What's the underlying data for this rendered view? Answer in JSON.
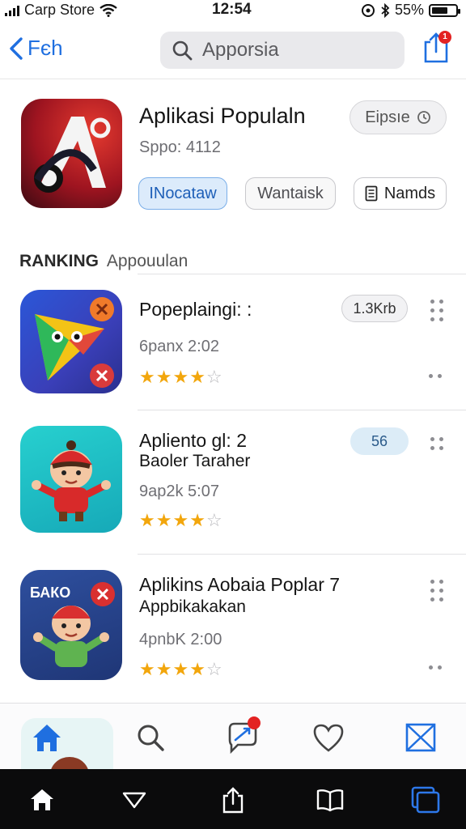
{
  "status_bar": {
    "carrier": "Carp Store",
    "time": "12:54",
    "battery": "55%",
    "battery_level": 0.55
  },
  "nav": {
    "back_label": "Fєh",
    "search_text": "Apporsia",
    "share_badge": "1"
  },
  "featured": {
    "title": "Aplikasi Populaln",
    "meta": "Sppo: 4112",
    "top_pill": "Eipsıe",
    "buttons": [
      "INocataw",
      "Wantaisk",
      "Namds"
    ]
  },
  "section": {
    "heading_strong": "RANKING",
    "heading_light": "Appouulan"
  },
  "apps": [
    {
      "title": "Popeplaingi: :",
      "meta": "6panx 2:02",
      "pill": "1.3Krb",
      "rating": 4
    },
    {
      "title": "Apliento gl: 2",
      "subtitle": "Baoler Taraher",
      "meta": "9ap2k 5:07",
      "pill": "56",
      "rating": 4
    },
    {
      "title": "Aplikins Aobaia Poplar 7",
      "subtitle": "Appbikakakan",
      "icon_text": "БАКО",
      "meta": "4pnbK 2:00",
      "rating": 4
    }
  ],
  "icons": {
    "back": "chevron-left-icon",
    "search": "search-icon",
    "share": "share-icon",
    "tabs": [
      "home-icon",
      "search-icon",
      "messages-icon",
      "heart-icon",
      "mail-icon"
    ],
    "system": [
      "home-icon",
      "back-triangle-icon",
      "share-icon",
      "book-icon",
      "recents-icon"
    ]
  },
  "colors": {
    "accent": "#1f6fe0",
    "star": "#f2a60c",
    "badge": "#e32222"
  }
}
